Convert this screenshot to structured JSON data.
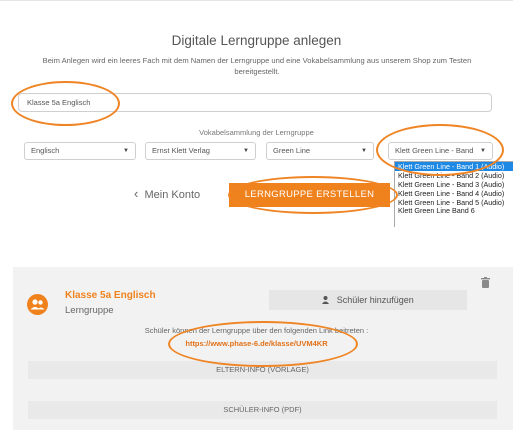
{
  "page": {
    "title": "Digitale Lerngruppe anlegen",
    "description": "Beim Anlegen wird ein leeres Fach mit dem Namen der Lerngruppe und eine Vokabelsammlung aus unserem Shop zum Testen bereitgestellt."
  },
  "form": {
    "group_name_value": "Klasse 5a Englisch",
    "vocab_label": "Vokabelsammlung der Lerngruppe",
    "selects": {
      "language": "Englisch",
      "publisher": "Ernst Klett Verlag",
      "series": "Green Line",
      "book": "Klett Green Line - Band"
    },
    "book_options": [
      "Klett Green Line - Band 1 (Audio)",
      "Klett Green Line - Band 2 (Audio)",
      "Klett Green Line - Band 3 (Audio)",
      "Klett Green Line - Band 4 (Audio)",
      "Klett Green Line - Band 5 (Audio)",
      "Klett Green Line Band 6"
    ],
    "back_label": "Mein Konto",
    "create_label": "LERNGRUPPE ERSTELLEN"
  },
  "group_card": {
    "name": "Klasse 5a Englisch",
    "type": "Lerngruppe",
    "add_students_label": "Schüler hinzufügen",
    "join_text": "Schüler können der Lerngruppe über den folgenden Link beitreten :",
    "join_link": "https://www.phase-6.de/klasse/UVM4KR",
    "parents_info_label": "ELTERN-INFO (VORLAGE)",
    "students_info_label": "SCHÜLER-INFO (PDF)"
  },
  "colors": {
    "accent": "#f0821e",
    "annotation": "#ef8424",
    "dropdown_highlight": "#1e88e5"
  },
  "icons": [
    "chevron-left-icon",
    "trash-icon",
    "group-icon",
    "user-icon",
    "dropdown-arrow-icon"
  ]
}
